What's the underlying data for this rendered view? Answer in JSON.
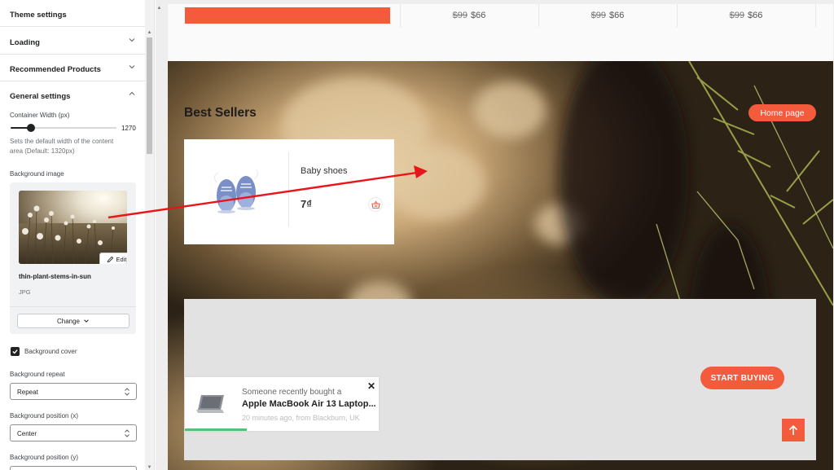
{
  "sidebar": {
    "sections": [
      {
        "label": "Theme settings"
      },
      {
        "label": "Loading"
      },
      {
        "label": "Recommended Products"
      },
      {
        "label": "General settings"
      }
    ],
    "container_width": {
      "label": "Container Width (px)",
      "value": "1270",
      "help": "Sets the default width of the content area (Default: 1320px)"
    },
    "background_image": {
      "label": "Background image",
      "file_name": "thin-plant-stems-in-sun",
      "file_type": "JPG",
      "edit_label": "Edit",
      "change_label": "Change"
    },
    "background_cover": {
      "label": "Background cover",
      "checked": true
    },
    "background_repeat": {
      "label": "Background repeat",
      "value": "Repeat"
    },
    "background_position_x": {
      "label": "Background position (x)",
      "value": "Center"
    },
    "background_position_y": {
      "label": "Background position (y)"
    }
  },
  "preview": {
    "prices": [
      {
        "old": "$99",
        "new": "$66"
      },
      {
        "old": "$99",
        "new": "$66"
      },
      {
        "old": "$99",
        "new": "$66"
      }
    ],
    "section_title": "Best Sellers",
    "home_pill": "Home page",
    "product": {
      "name": "Baby shoes",
      "price": "7₫"
    },
    "cta": "START BUYING",
    "toast": {
      "line1": "Someone recently bought a",
      "product": "Apple MacBook Air 13 Laptop...",
      "meta": "20 minutes ago, from Blackburn, UK"
    }
  },
  "colors": {
    "accent": "#f45b3d",
    "progress": "#58c073"
  }
}
